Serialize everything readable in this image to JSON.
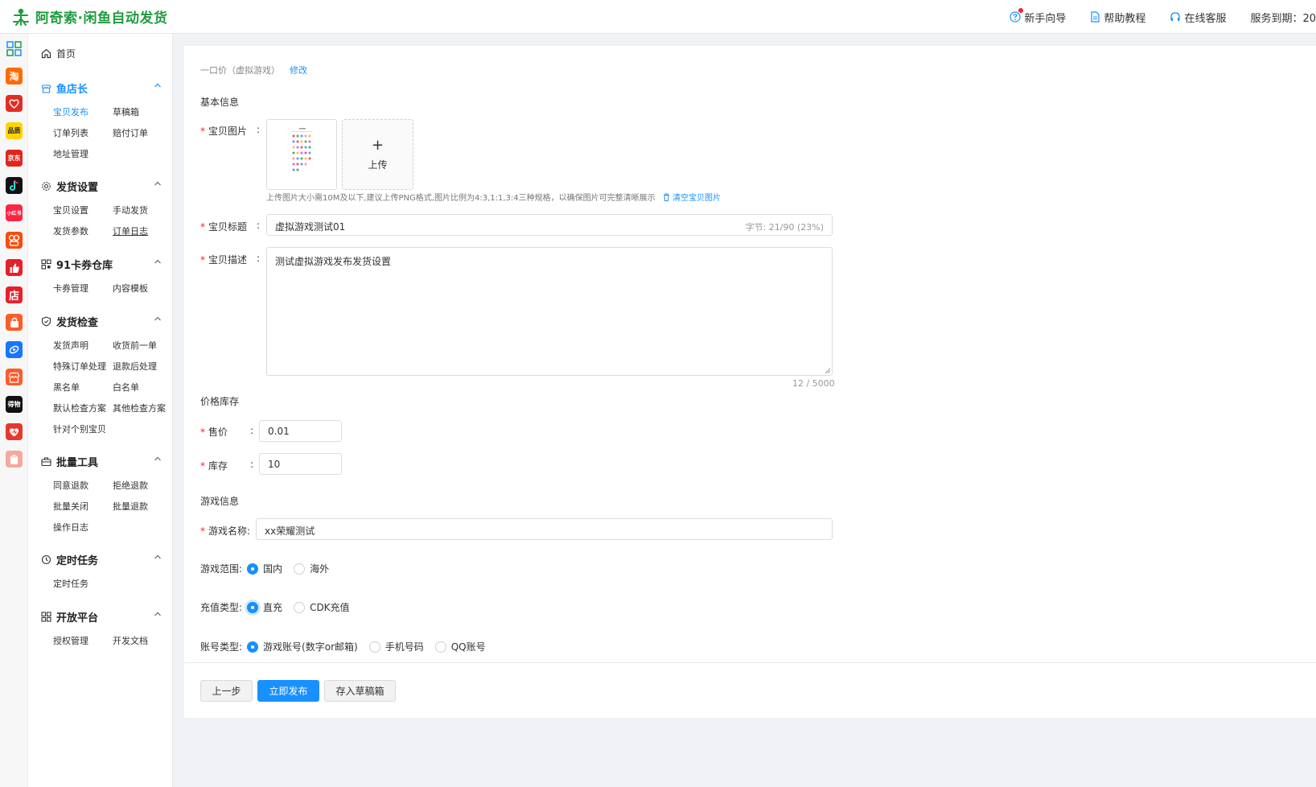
{
  "header": {
    "brand": "阿奇索·闲鱼自动发货",
    "brand_color": "#1f9b3f",
    "links": {
      "guide": "新手向导",
      "tutorial": "帮助教程",
      "support": "在线客服",
      "expire": "服务到期：20"
    }
  },
  "rail": {
    "icons": [
      "grid-icon",
      "taobao-icon",
      "pinduoduo-icon",
      "haoxiang-icon",
      "jd-icon",
      "douyin-icon",
      "xiaohongshu-icon",
      "kuaishou-icon",
      "thumb-icon",
      "store-icon",
      "bag-icon",
      "link-icon",
      "shop-icon",
      "dewu-icon",
      "heart-icon",
      "clipboard-icon"
    ],
    "labels": {
      "taobao": "淘",
      "haoxiang": "品质",
      "jd": "京东",
      "xiaohongshu": "小红书",
      "store": "店",
      "dewu": "得物"
    }
  },
  "sidebar": {
    "home": "首页",
    "groups": [
      {
        "title": "鱼店长",
        "items": [
          "宝贝发布",
          "草稿箱",
          "订单列表",
          "赔付订单",
          "地址管理"
        ]
      },
      {
        "title": "发货设置",
        "items": [
          "宝贝设置",
          "手动发货",
          "发货参数",
          "订单日志"
        ]
      },
      {
        "title": "91卡券仓库",
        "items": [
          "卡券管理",
          "内容模板"
        ]
      },
      {
        "title": "发货检查",
        "items": [
          "发货声明",
          "收货前一单",
          "特殊订单处理",
          "退款后处理",
          "黑名单",
          "白名单",
          "默认检查方案",
          "其他检查方案",
          "针对个别宝贝"
        ]
      },
      {
        "title": "批量工具",
        "items": [
          "同意退款",
          "拒绝退款",
          "批量关闭",
          "批量退款",
          "操作日志"
        ]
      },
      {
        "title": "定时任务",
        "items": [
          "定时任务"
        ]
      },
      {
        "title": "开放平台",
        "items": [
          "授权管理",
          "开发文档"
        ]
      }
    ]
  },
  "main": {
    "crumb": "一口价（虚拟游戏）",
    "crumb_edit": "修改",
    "basic_title": "基本信息",
    "pic_label": "宝贝图片",
    "upload_label": "上传",
    "pic_hint": "上传图片大小需10M及以下,建议上传PNG格式,图片比例为4:3,1:1,3:4三种规格，以确保图片可完整清晰展示",
    "pic_clear": "清空宝贝图片",
    "title_label": "宝贝标题",
    "title_value": "虚拟游戏测试01",
    "title_counter": "字节: 21/90 (23%)",
    "desc_label": "宝贝描述",
    "desc_value": "测试虚拟游戏发布发货设置",
    "desc_counter": "12 / 5000",
    "price_title": "价格库存",
    "price_label": "售价",
    "price_value": "0.01",
    "stock_label": "库存",
    "stock_value": "10",
    "game_title": "游戏信息",
    "game_name_label": "游戏名称:",
    "game_name_value": "xx荣耀测试",
    "scope_label": "游戏范围:",
    "scope_options": [
      "国内",
      "海外"
    ],
    "recharge_label": "充值类型:",
    "recharge_options": [
      "直充",
      "CDK充值"
    ],
    "account_label": "账号类型:",
    "account_options": [
      "游戏账号(数字or邮箱)",
      "手机号码",
      "QQ账号"
    ],
    "buttons": {
      "prev": "上一步",
      "publish": "立即发布",
      "draft": "存入草稿箱"
    },
    "accent": "#1890ff",
    "required_color": "#f5222d"
  }
}
